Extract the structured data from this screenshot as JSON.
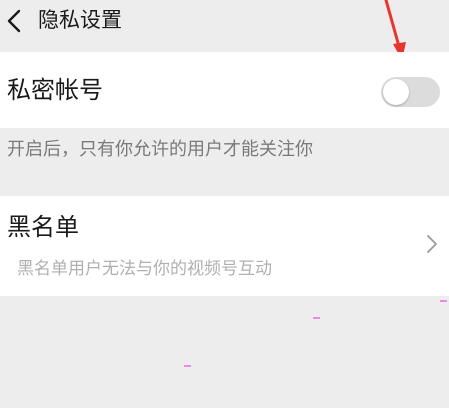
{
  "header": {
    "title": "隐私设置",
    "back_icon": "chevron-left-icon"
  },
  "private_account": {
    "label": "私密帐号",
    "toggle_on": false,
    "hint": "开启后，只有你允许的用户才能关注你"
  },
  "blacklist": {
    "label": "黑名单",
    "description": "黑名单用户无法与你的视频号互动",
    "chevron_icon": "chevron-right-icon"
  },
  "annotation": {
    "arrow_color": "#e8352e"
  },
  "colors": {
    "background": "#ededed",
    "card": "#ffffff",
    "toggle_off": "#dcdcdc",
    "hint_text": "#7a7a7a",
    "desc_text": "#b0b0b0"
  }
}
